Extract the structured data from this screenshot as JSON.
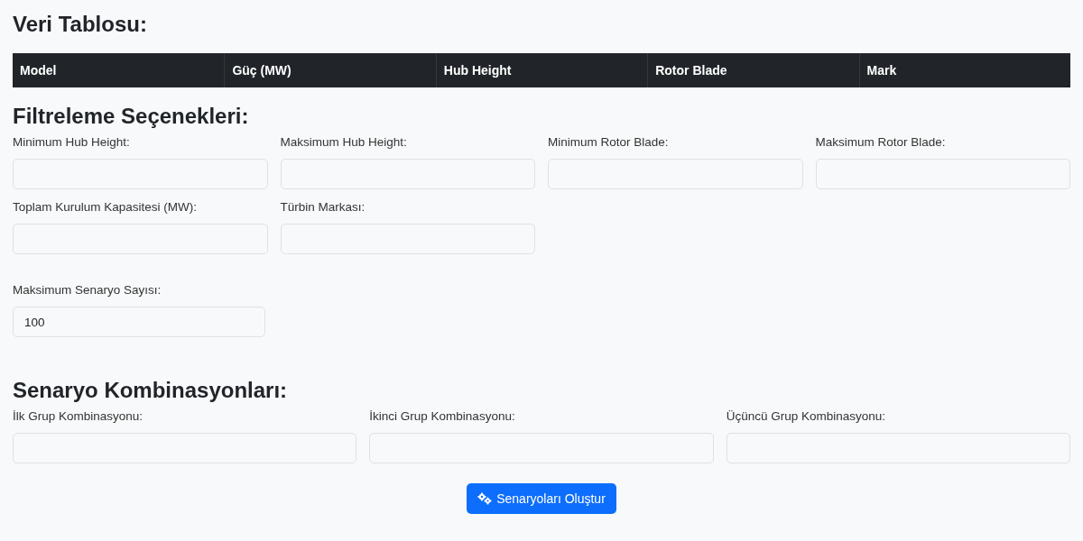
{
  "data_table": {
    "title": "Veri Tablosu:",
    "columns": [
      "Model",
      "Güç (MW)",
      "Hub Height",
      "Rotor Blade",
      "Mark"
    ]
  },
  "filters": {
    "title": "Filtreleme Seçenekleri:",
    "fields": [
      {
        "label": "Minimum Hub Height:"
      },
      {
        "label": "Maksimum Hub Height:"
      },
      {
        "label": "Minimum Rotor Blade:"
      },
      {
        "label": "Maksimum Rotor Blade:"
      },
      {
        "label": "Toplam Kurulum Kapasitesi (MW):"
      },
      {
        "label": "Türbin Markası:"
      }
    ],
    "max_scenarios": {
      "label": "Maksimum Senaryo Sayısı:",
      "value": "100"
    }
  },
  "combinations": {
    "title": "Senaryo Kombinasyonları:",
    "fields": [
      {
        "label": "İlk Grup Kombinasyonu:"
      },
      {
        "label": "İkinci Grup Kombinasyonu:"
      },
      {
        "label": "Üçüncü Grup Kombinasyonu:"
      }
    ]
  },
  "generate_button": "Senaryoları Oluştur"
}
